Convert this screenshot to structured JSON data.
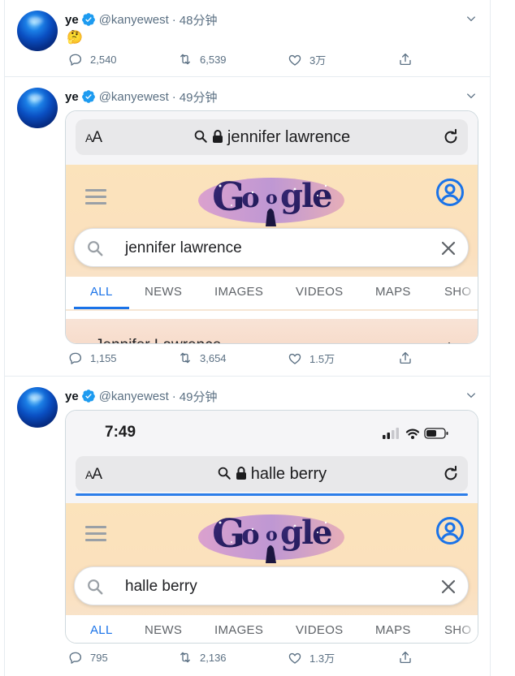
{
  "tweets": [
    {
      "name": "ye",
      "handle": "@kanyewest",
      "separator": "·",
      "time": "48分钟",
      "text": "🤔",
      "replies": "2,540",
      "retweets": "6,539",
      "likes": "3万"
    },
    {
      "name": "ye",
      "handle": "@kanyewest",
      "separator": "·",
      "time": "49分钟",
      "replies": "1,155",
      "retweets": "3,654",
      "likes": "1.5万",
      "screenshot": {
        "aa_small": "A",
        "aa_large": "A",
        "url": "jennifer lawrence",
        "query": "jennifer lawrence",
        "result_peek": "Jennifer Lawrence",
        "kebab": "⋮"
      }
    },
    {
      "name": "ye",
      "handle": "@kanyewest",
      "separator": "·",
      "time": "49分钟",
      "replies": "795",
      "retweets": "2,136",
      "likes": "1.3万",
      "screenshot": {
        "clock": "7:49",
        "aa_small": "A",
        "aa_large": "A",
        "url": "halle berry",
        "query": "halle berry"
      }
    }
  ],
  "google_tabs": [
    "ALL",
    "NEWS",
    "IMAGES",
    "VIDEOS",
    "MAPS",
    "SHO"
  ],
  "colors": {
    "verified": "#1d9bf0",
    "google_blue": "#1a73e8",
    "meta_gray": "#5b7083"
  }
}
